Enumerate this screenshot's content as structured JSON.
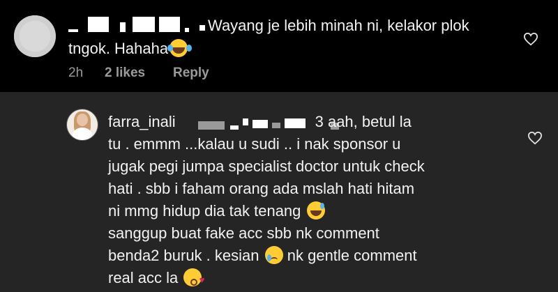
{
  "comment": {
    "text": "Wayang je lebih minah ni, kelakor plok tngok. Hahaha",
    "time": "2h",
    "likes": "2 likes",
    "reply_label": "Reply"
  },
  "reply": {
    "username": "farra_inali",
    "text_lines": [
      "3  aah, betul la",
      "tu . emmm ...kalau u sudi .. i nak sponsor u",
      "jugak pegi jumpa specialist doctor untuk check",
      "hati .  sbb i faham orang ada mslah hati hitam",
      "ni mmg hidup dia tak tenang",
      "sanggup buat fake acc sbb nk comment",
      "benda2 buruk . kesian",
      "nk gentle comment",
      "real acc la"
    ]
  },
  "icons": {
    "like": "heart-outline-icon",
    "emoji_laugh": "tears-of-joy-emoji",
    "emoji_sweat": "grinning-sweat-emoji",
    "emoji_cry": "crying-face-emoji",
    "emoji_kiss": "face-blowing-kiss-emoji"
  },
  "colors": {
    "background": "#000000",
    "reply_background": "#252525",
    "text": "#f2f2f2",
    "meta": "#9a9a9a"
  }
}
